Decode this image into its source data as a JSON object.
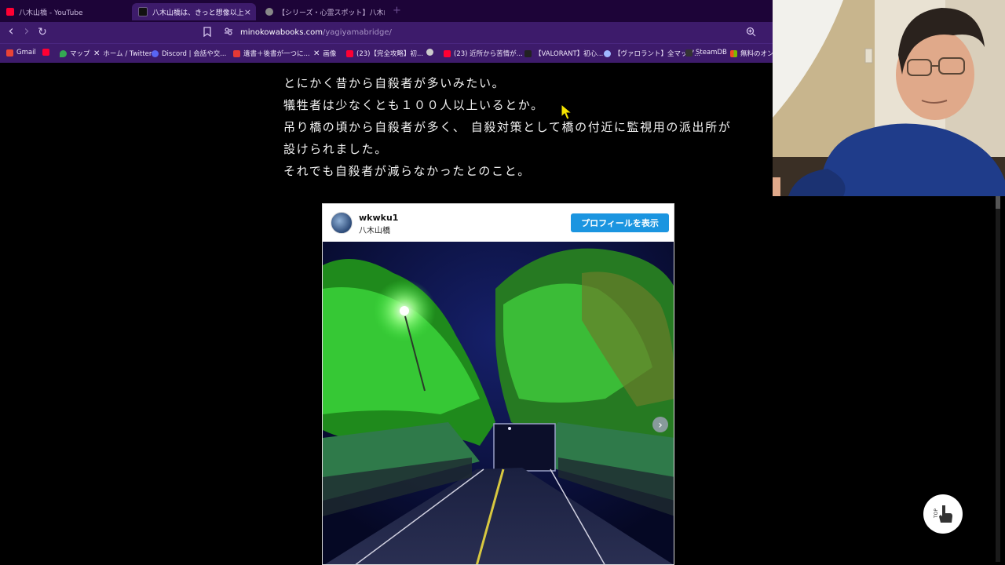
{
  "tabs": [
    {
      "title": "八木山橋 - YouTube",
      "favicon_color": "#ff0033"
    },
    {
      "title": "八木山橋は、きっと想像以上だ。 » /",
      "favicon_color": "#111111"
    },
    {
      "title": "【シリーズ・心霊スポット】八木山橋 | ソソ",
      "favicon_color": "#888888"
    }
  ],
  "toolbar": {
    "back_icon": "‹",
    "forward_icon": "›",
    "reload_icon": "↻",
    "url_domain": "minokowabooks.com",
    "url_path": "/yagiyamabridge/"
  },
  "bookmarks": [
    {
      "label": "Gmail",
      "color": "#ea4335"
    },
    {
      "label": "",
      "color": "#ff0033"
    },
    {
      "label": "マップ",
      "color": "#34a853"
    },
    {
      "label": "ホーム / Twitter",
      "color": "#ffffff"
    },
    {
      "label": "Discord | 会話や交...",
      "color": "#5865f2"
    },
    {
      "label": "遺書＋後書が一つに...",
      "color": "#e53935"
    },
    {
      "label": "画像",
      "color": "#ffffff"
    },
    {
      "label": "(23)【完全攻略】初...",
      "color": "#ff0033"
    },
    {
      "label": "",
      "color": "#cccccc"
    },
    {
      "label": "(23) 近所から苦情が...",
      "color": "#ff0033"
    },
    {
      "label": "【VALORANT】初心...",
      "color": "#222222"
    },
    {
      "label": "【ヴァロラント】全マップ...",
      "color": "#9fb8ff"
    },
    {
      "label": "SteamDB",
      "color": "#333333"
    },
    {
      "label": "無料のオンラ",
      "color": "#f25022"
    }
  ],
  "article": {
    "lines": [
      "とにかく昔から自殺者が多いみたい。",
      "犠牲者は少なくとも１００人以上いるとか。",
      "吊り橋の頃から自殺者が多く、 自殺対策として橋の付近に監視用の派出所が",
      "設けられました。",
      "それでも自殺者が減らなかったとのこと。"
    ]
  },
  "embed": {
    "username": "wkwku1",
    "location": "八木山橋",
    "profile_button": "プロフィールを表示",
    "next_icon": "›"
  },
  "top_button": {
    "label": "TOP"
  }
}
